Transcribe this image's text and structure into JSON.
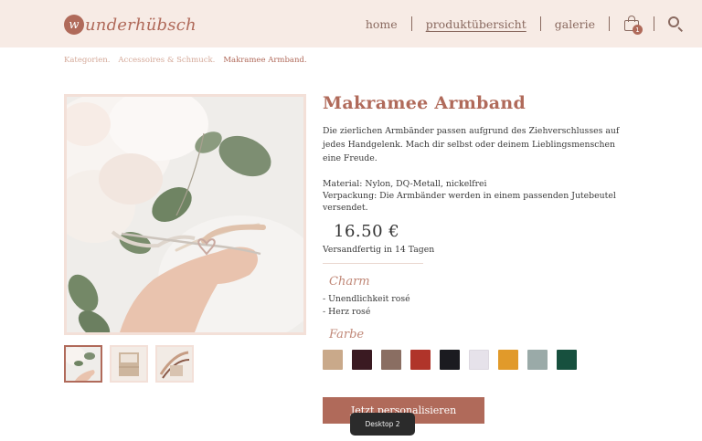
{
  "header": {
    "logo": {
      "badge": "w",
      "text": "underhübsch"
    },
    "nav": {
      "home": "home",
      "products": "produktübersicht",
      "gallery": "galerie"
    },
    "cart_count": "1",
    "icons": {
      "cart": "shopping-bag-icon",
      "search": "search-icon"
    }
  },
  "breadcrumb": {
    "items": [
      "Kategorien.",
      "Accessoires & Schmuck.",
      "Makramee Armband."
    ]
  },
  "product": {
    "title": "Makramee Armband",
    "description": "Die zierlichen Armbänder passen aufgrund des Ziehverschlusses auf jedes Handgelenk. Mach dir selbst oder deinem Lieblingsmenschen eine Freude.",
    "material": "Material: Nylon, DQ-Metall, nickelfrei",
    "packaging": "Verpackung: Die Armbänder werden in einem passenden Jutebeutel versendet.",
    "price": "16.50 €",
    "shipping": "Versandfertig in 14 Tagen",
    "charm": {
      "heading": "Charm",
      "options": [
        "- Unendlichkeit rosé",
        "- Herz rosé"
      ]
    },
    "color": {
      "heading": "Farbe",
      "swatches": [
        "#c9a98a",
        "#3a1a22",
        "#8a6e62",
        "#b0342a",
        "#1b1b20",
        "#e6e2ea",
        "#e19a2a",
        "#9aaaa8",
        "#17503e"
      ]
    },
    "cta": "Jetzt personalisieren"
  },
  "tooltip": "Desktop 2",
  "colors": {
    "accent": "#b06a5a",
    "header_bg": "#f7ebe5",
    "frame": "#f3e0d8"
  }
}
